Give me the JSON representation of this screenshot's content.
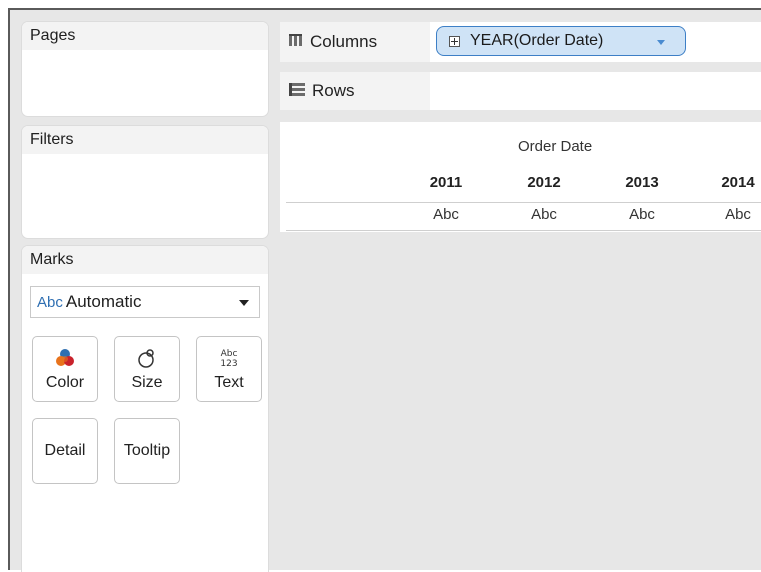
{
  "pages": {
    "title": "Pages"
  },
  "filters": {
    "title": "Filters"
  },
  "marks": {
    "title": "Marks",
    "mark_type": {
      "prefix": "Abc",
      "value": "Automatic"
    },
    "buttons": [
      {
        "label": "Color",
        "icon": "color-icon"
      },
      {
        "label": "Size",
        "icon": "size-icon"
      },
      {
        "label": "Text",
        "icon": "text-icon"
      },
      {
        "label": "Detail"
      },
      {
        "label": "Tooltip"
      }
    ]
  },
  "shelves": {
    "columns": {
      "label": "Columns",
      "icon": "columns-icon",
      "pill": "YEAR(Order Date)"
    },
    "rows": {
      "label": "Rows",
      "icon": "rows-icon"
    }
  },
  "view": {
    "header_title": "Order Date",
    "years": [
      "2011",
      "2012",
      "2013",
      "2014"
    ],
    "cells": [
      "Abc",
      "Abc",
      "Abc",
      "Abc"
    ]
  },
  "colors": {
    "pill_fill": "#cfe3f6",
    "pill_border": "#3d7fc6",
    "mark_abc": "#2f6fb2",
    "canvas": "#e7e7e7"
  }
}
